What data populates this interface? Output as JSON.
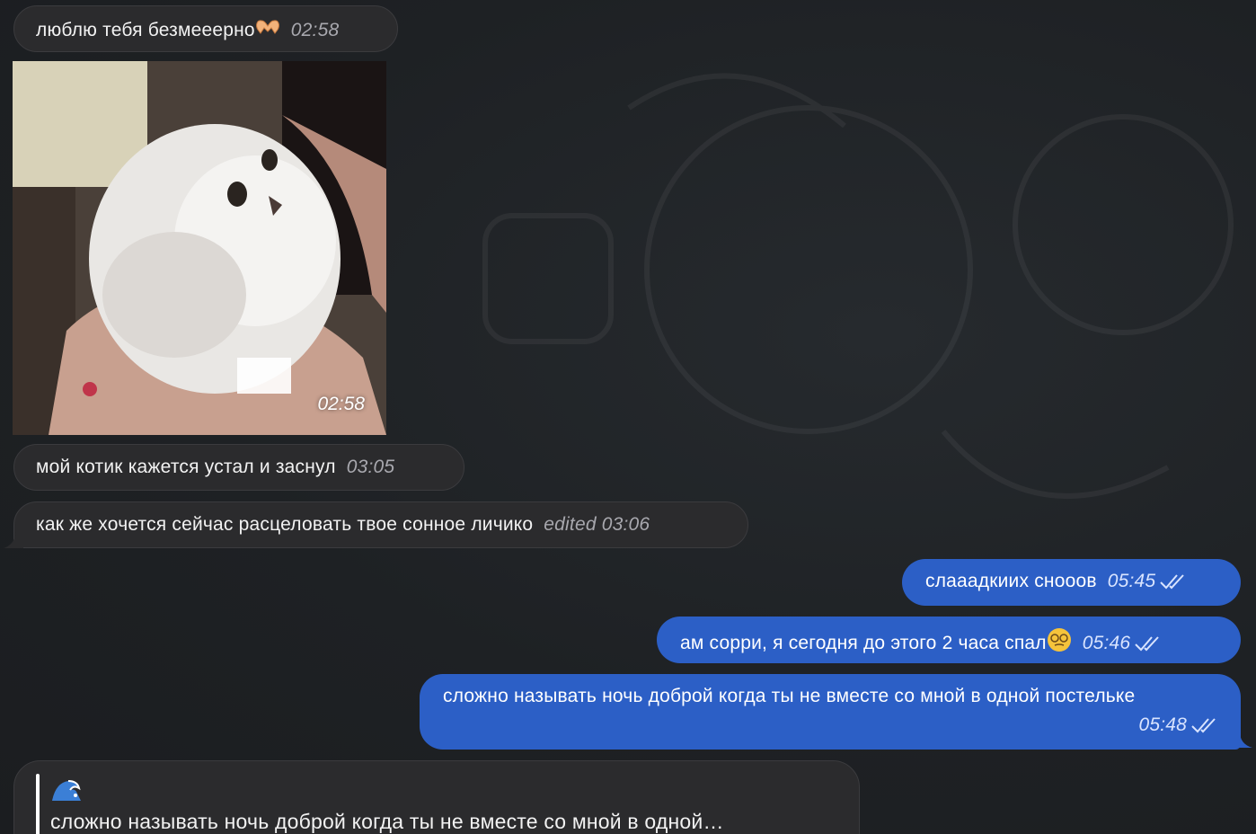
{
  "messages": [
    {
      "id": "m1",
      "direction": "incoming",
      "text": "люблю тебя безмееерно",
      "emoji": "heart-hands-emoji",
      "time": "02:58"
    },
    {
      "id": "m2",
      "direction": "incoming",
      "type": "video",
      "media_description": "white fluffy kitten held in hands",
      "time": "02:58"
    },
    {
      "id": "m3",
      "direction": "incoming",
      "text": "мой котик кажется устал и заснул",
      "time": "03:05"
    },
    {
      "id": "m4",
      "direction": "incoming",
      "text": "как же хочется сейчас расцеловать твое сонное личико",
      "time": "edited 03:06"
    },
    {
      "id": "m5",
      "direction": "outgoing",
      "text": "слааадкиих сноoов",
      "time": "05:45",
      "status": "read"
    },
    {
      "id": "m6",
      "direction": "outgoing",
      "text": "ам сорри, я сегодня до этого 2 часа спал",
      "emoji": "dizzy-face-emoji",
      "time": "05:46",
      "status": "read"
    },
    {
      "id": "m7",
      "direction": "outgoing",
      "text": "сложно называть ночь доброй когда ты не вместе со мной в одной постельке",
      "time": "05:48",
      "status": "read"
    },
    {
      "id": "m8",
      "direction": "incoming",
      "reply_emoji": "wave-emoji",
      "reply_quote": "сложно называть ночь доброй когда ты не вместе со мной в одной…"
    }
  ],
  "colors": {
    "background": "#1d2023",
    "incoming_bubble": "#2b2b2d",
    "outgoing_bubble": "#2c5fc6"
  }
}
